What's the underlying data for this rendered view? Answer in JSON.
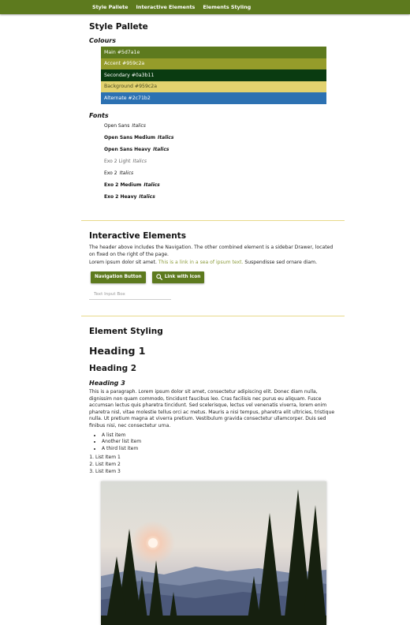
{
  "nav": {
    "items": [
      "Style Pallete",
      "Interactive Elements",
      "Elements Styling"
    ]
  },
  "palette": {
    "title": "Style Pallete",
    "colours_heading": "Colours",
    "colours": [
      {
        "label": "Main #5d7a1e",
        "color": "#5d7a1e",
        "text": "#ffffff"
      },
      {
        "label": "Accent #959c2a",
        "color": "#959c2a",
        "text": "#ffffff"
      },
      {
        "label": "Secondary #0a3b11",
        "color": "#0a3b11",
        "text": "#ffffff"
      },
      {
        "label": "Background #959c2a",
        "color": "#e2d26e",
        "text": "#4a4a1e"
      },
      {
        "label": "Alternate #2c71b2",
        "color": "#2c71b2",
        "text": "#ffffff"
      }
    ],
    "fonts_heading": "Fonts",
    "fonts": [
      {
        "name": "Open Sans",
        "italic": "Italics"
      },
      {
        "name": "Open Sans Medium",
        "italic": "Italics"
      },
      {
        "name": "Open Sans Heavy",
        "italic": "Italics"
      },
      {
        "name": "Exo 2 Light",
        "italic": "Italics"
      },
      {
        "name": "Exo 2",
        "italic": "Italics"
      },
      {
        "name": "Exo 2 Medium",
        "italic": "Italics"
      },
      {
        "name": "Exo 2 Heavy",
        "italic": "Italics"
      }
    ]
  },
  "interactive": {
    "title": "Interactive Elements",
    "para1": "The header above includes the Navigation. The other combined element is a sidebar Drawer, located on fixed on the right of the page.",
    "para2_before": "Lorem ipsum dolor sit amet.",
    "para2_link": "This is a link in a sea of ipsum text.",
    "para2_after": "Suspendisse sed ornare diam.",
    "nav_button": "Navigation Button",
    "icon_button": "Link with Icon",
    "input_placeholder": "Text Input Box"
  },
  "styling": {
    "title": "Element Styling",
    "h1": "Heading 1",
    "h2": "Heading 2",
    "h3": "Heading 3",
    "paragraph": "This is a paragraph. Lorem ipsum dolor sit amet, consectetur adipiscing elit. Donec diam nulla, dignissim non quam commodo, tincidunt faucibus leo. Cras facilisis nec purus eu aliquam. Fusce accumsan lectus quis pharetra tincidunt. Sed scelerisque, lectus vel venenatis viverra, lorem enim pharetra nisl, vitae molestie tellus orci ac metus. Mauris a nisi tempus, pharetra elit ultricies, tristique nulla. Ut pretium magna at viverra pretium. Vestibulum gravida consectetur ullamcorper. Duis sed finibus nisi, nec consectetur urna.",
    "ul": [
      "A list item",
      "Another list item",
      "A third list item"
    ],
    "ol": [
      "List Item 1",
      "List Item 2",
      "List Item 3"
    ]
  }
}
